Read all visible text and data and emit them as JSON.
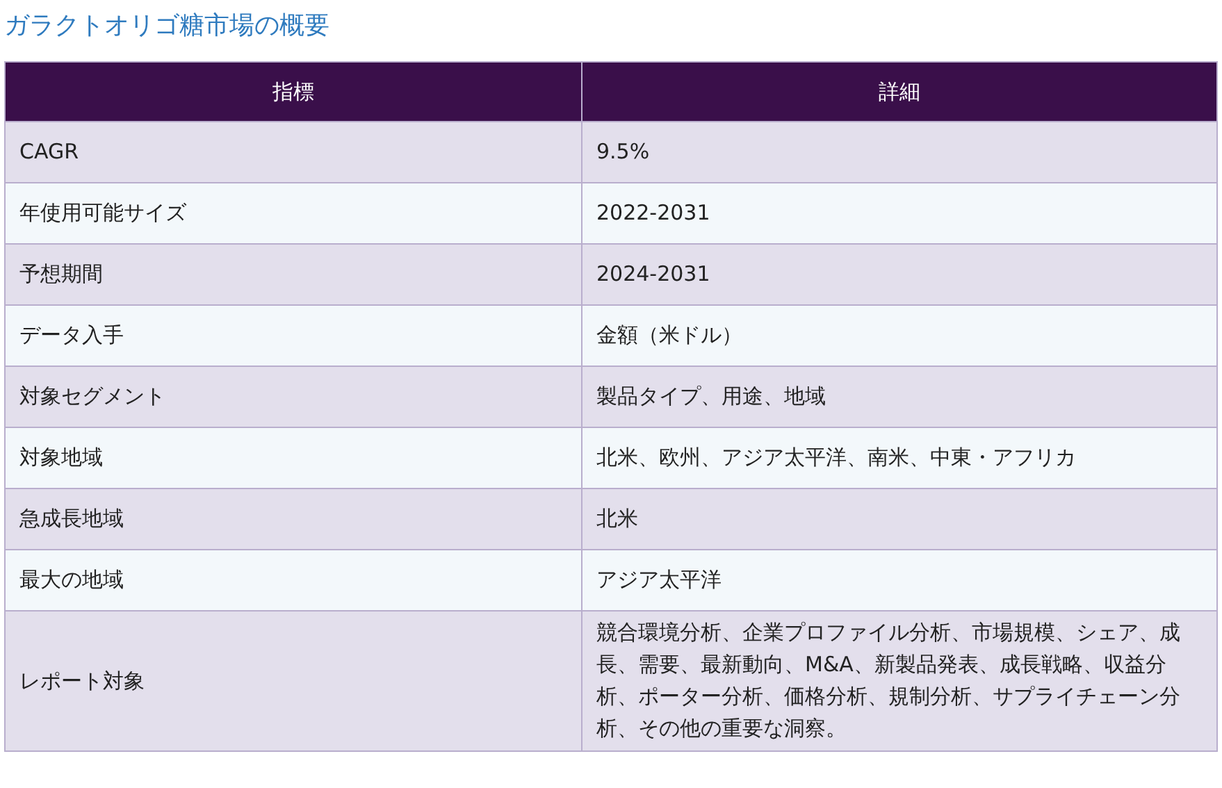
{
  "title": "ガラクトオリゴ糖市場の概要",
  "table": {
    "columns": [
      "指標",
      "詳細"
    ],
    "rows": [
      {
        "label": "CAGR",
        "value": "9.5%"
      },
      {
        "label": "年使用可能サイズ",
        "value": "2022-2031"
      },
      {
        "label": "予想期間",
        "value": "2024-2031"
      },
      {
        "label": "データ入手",
        "value": "金額（米ドル）"
      },
      {
        "label": "対象セグメント",
        "value": "製品タイプ、用途、地域"
      },
      {
        "label": "対象地域",
        "value": "北米、欧州、アジア太平洋、南米、中東・アフリカ"
      },
      {
        "label": "急成長地域",
        "value": "北米"
      },
      {
        "label": "最大の地域",
        "value": "アジア太平洋"
      },
      {
        "label": "レポート対象",
        "value": "競合環境分析、企業プロファイル分析、市場規模、シェア、成長、需要、最新動向、M&A、新製品発表、成長戦略、収益分析、ポーター分析、価格分析、規制分析、サプライチェーン分析、その他の重要な洞察。"
      }
    ]
  }
}
